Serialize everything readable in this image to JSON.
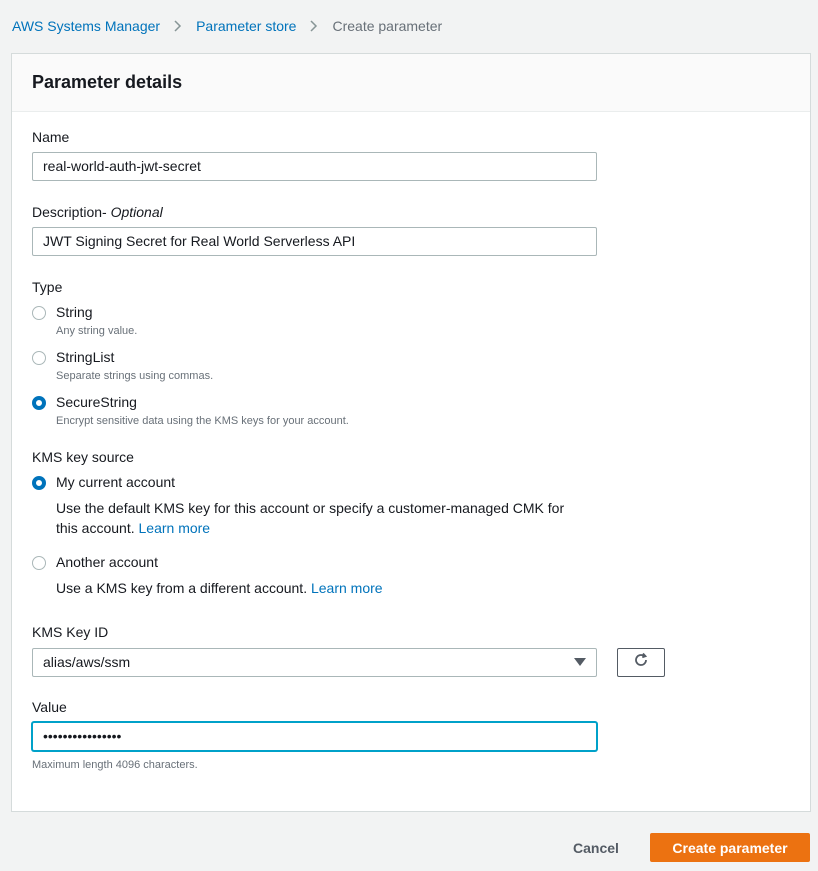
{
  "breadcrumb": {
    "items": [
      "AWS Systems Manager",
      "Parameter store"
    ],
    "current": "Create parameter"
  },
  "panel": {
    "title": "Parameter details"
  },
  "name_field": {
    "label": "Name",
    "value": "real-world-auth-jwt-secret"
  },
  "description_field": {
    "label": "Description-",
    "optional": "Optional",
    "value": "JWT Signing Secret for Real World Serverless API"
  },
  "type": {
    "label": "Type",
    "selected": "SecureString",
    "options": [
      {
        "label": "String",
        "description": "Any string value."
      },
      {
        "label": "StringList",
        "description": "Separate strings using commas."
      },
      {
        "label": "SecureString",
        "description": "Encrypt sensitive data using the KMS keys for your account."
      }
    ]
  },
  "kms_source": {
    "label": "KMS key source",
    "selected": "My current account",
    "options": [
      {
        "label": "My current account",
        "description": "Use the default KMS key for this account or specify a customer-managed CMK for this account.",
        "link": "Learn more"
      },
      {
        "label": "Another account",
        "description": "Use a KMS key from a different account.",
        "link": "Learn more"
      }
    ]
  },
  "kms_key": {
    "label": "KMS Key ID",
    "value": "alias/aws/ssm"
  },
  "value_field": {
    "label": "Value",
    "value": "••••••••••••••••",
    "hint": "Maximum length 4096 characters."
  },
  "actions": {
    "cancel": "Cancel",
    "create": "Create parameter"
  },
  "colors": {
    "link": "#0073bb",
    "primary": "#ec7211",
    "focus": "#00a1c9"
  },
  "icons": {
    "separator": "chevron-right-icon",
    "refresh": "refresh-icon",
    "dropdown": "caret-down-icon"
  }
}
